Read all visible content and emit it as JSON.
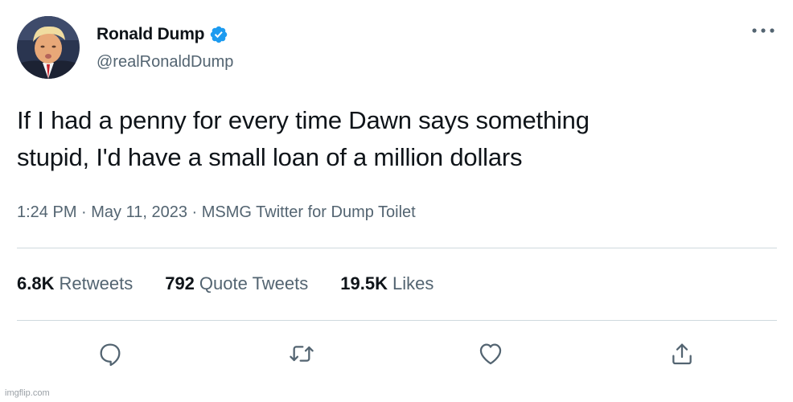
{
  "tweet": {
    "display_name": "Ronald Dump",
    "handle": "@realRonaldDump",
    "verified": true,
    "verified_color": "#1d9bf0",
    "text_line1": "If I had a penny for every time Dawn says something",
    "text_line2": "stupid, I'd have a small loan of a million dollars",
    "meta": "1:24 PM · May 11, 2023 · MSMG Twitter for Dump Toilet"
  },
  "stats": {
    "retweets_count": "6.8K",
    "retweets_label": "Retweets",
    "quote_count": "792",
    "quote_label": "Quote Tweets",
    "likes_count": "19.5K",
    "likes_label": "Likes"
  },
  "actions": {
    "icons": [
      "reply-icon",
      "retweet-icon",
      "like-icon",
      "share-icon"
    ],
    "icon_color": "#536471"
  },
  "watermark": "imgflip.com"
}
